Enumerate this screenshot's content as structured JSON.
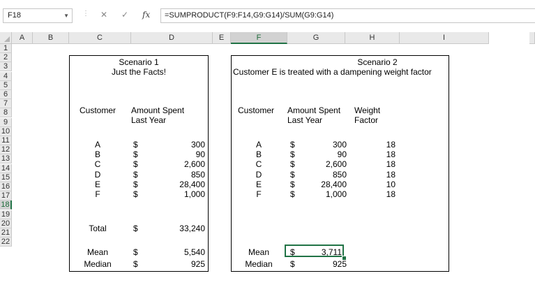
{
  "formula_bar": {
    "name_box": "F18",
    "formula": "=SUMPRODUCT(F9:F14,G9:G14)/SUM(G9:G14)",
    "fx_label": "fx"
  },
  "columns": [
    "A",
    "B",
    "C",
    "D",
    "E",
    "F",
    "G",
    "H",
    "I"
  ],
  "selected_column": "F",
  "rows": [
    "1",
    "2",
    "3",
    "4",
    "5",
    "6",
    "7",
    "8",
    "9",
    "10",
    "11",
    "12",
    "13",
    "14",
    "15",
    "16",
    "17",
    "18",
    "19",
    "20",
    "21",
    "22"
  ],
  "selected_row": "18",
  "scenario1": {
    "title": "Scenario 1",
    "subtitle": "Just the Facts!",
    "customer_header": "Customer",
    "amount_header_1": "Amount Spent",
    "amount_header_2": "Last Year",
    "rows": [
      {
        "customer": "A",
        "currency": "$",
        "amount": "300"
      },
      {
        "customer": "B",
        "currency": "$",
        "amount": "90"
      },
      {
        "customer": "C",
        "currency": "$",
        "amount": "2,600"
      },
      {
        "customer": "D",
        "currency": "$",
        "amount": "850"
      },
      {
        "customer": "E",
        "currency": "$",
        "amount": "28,400"
      },
      {
        "customer": "F",
        "currency": "$",
        "amount": "1,000"
      }
    ],
    "total_label": "Total",
    "total_currency": "$",
    "total_value": "33,240",
    "mean_label": "Mean",
    "mean_currency": "$",
    "mean_value": "5,540",
    "median_label": "Median",
    "median_currency": "$",
    "median_value": "925"
  },
  "scenario2": {
    "title": "Scenario 2",
    "subtitle": "Customer E is treated with a dampening weight factor",
    "customer_header": "Customer",
    "amount_header_1": "Amount Spent",
    "amount_header_2": "Last Year",
    "weight_header_1": "Weight",
    "weight_header_2": "Factor",
    "rows": [
      {
        "customer": "A",
        "currency": "$",
        "amount": "300",
        "weight": "18"
      },
      {
        "customer": "B",
        "currency": "$",
        "amount": "90",
        "weight": "18"
      },
      {
        "customer": "C",
        "currency": "$",
        "amount": "2,600",
        "weight": "18"
      },
      {
        "customer": "D",
        "currency": "$",
        "amount": "850",
        "weight": "18"
      },
      {
        "customer": "E",
        "currency": "$",
        "amount": "28,400",
        "weight": "10"
      },
      {
        "customer": "F",
        "currency": "$",
        "amount": "1,000",
        "weight": "18"
      }
    ],
    "mean_label": "Mean",
    "mean_currency": "$",
    "mean_value": "3,711",
    "median_label": "Median",
    "median_currency": "$",
    "median_value": "925"
  }
}
